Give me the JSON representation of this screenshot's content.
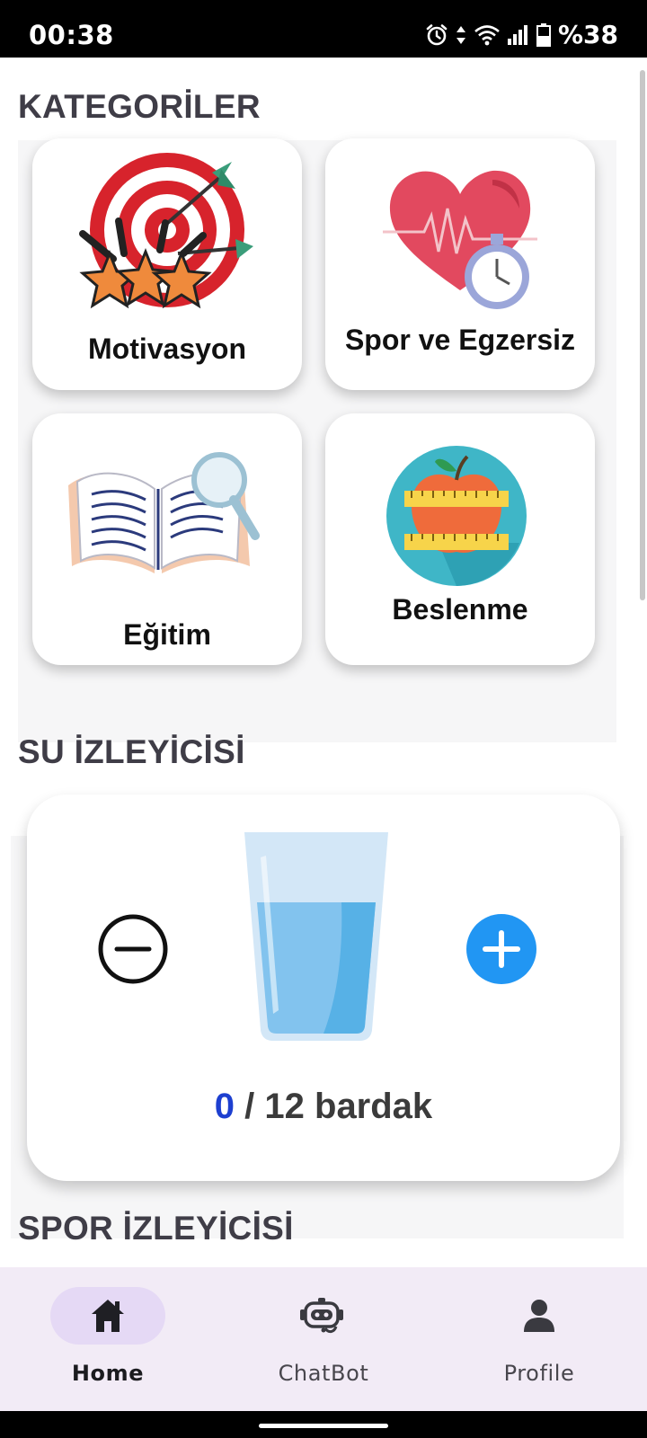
{
  "status_bar": {
    "time": "00:38",
    "battery": "%38",
    "icons": [
      "alarm-icon",
      "data-arrows-icon",
      "wifi-icon",
      "signal-icon",
      "battery-icon"
    ]
  },
  "categories": {
    "title": "KATEGORİLER",
    "items": [
      {
        "label": "Motivasyon",
        "icon": "target-darts-stars-icon"
      },
      {
        "label": "Spor ve Egzersiz",
        "icon": "heart-stopwatch-icon"
      },
      {
        "label": "Eğitim",
        "icon": "book-magnifier-icon"
      },
      {
        "label": "Beslenme",
        "icon": "apple-measuring-tape-icon"
      }
    ]
  },
  "water_tracker": {
    "title": "SU İZLEYİCİSİ",
    "current": "0",
    "goal_text": "/ 12 bardak",
    "minus_icon": "minus-circle-icon",
    "plus_icon": "plus-circle-icon",
    "accent": "#1d3fd0",
    "plus_color": "#2196f3"
  },
  "sport_tracker": {
    "title": "SPOR İZLEYİCİSİ"
  },
  "bottom_nav": {
    "items": [
      {
        "label": "Home",
        "icon": "home-icon",
        "active": true
      },
      {
        "label": "ChatBot",
        "icon": "robot-icon",
        "active": false
      },
      {
        "label": "Profile",
        "icon": "person-icon",
        "active": false
      }
    ],
    "background": "#f2ebf6",
    "active_pill": "#e5d9f5"
  }
}
